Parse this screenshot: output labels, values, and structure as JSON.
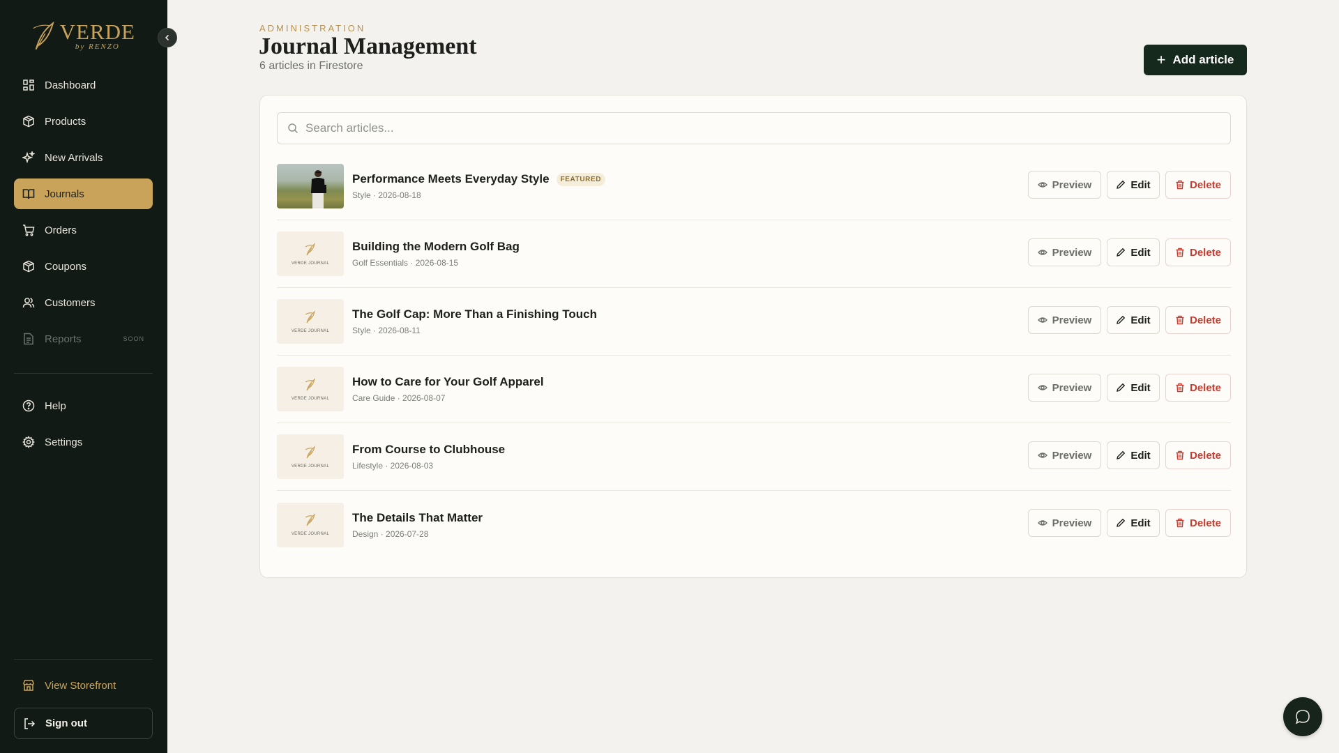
{
  "brand": {
    "name": "VERDE",
    "sub": "by RENZO"
  },
  "nav": {
    "items": [
      {
        "label": "Dashboard",
        "icon": "grid-icon"
      },
      {
        "label": "Products",
        "icon": "box-icon"
      },
      {
        "label": "New Arrivals",
        "icon": "sparkles-icon"
      },
      {
        "label": "Journals",
        "icon": "book-open-icon",
        "active": true
      },
      {
        "label": "Orders",
        "icon": "cart-icon"
      },
      {
        "label": "Coupons",
        "icon": "box-icon"
      },
      {
        "label": "Customers",
        "icon": "users-icon"
      },
      {
        "label": "Reports",
        "icon": "file-icon",
        "badge": "SOON",
        "disabled": true
      }
    ],
    "secondary": [
      {
        "label": "Help",
        "icon": "help-circle-icon"
      },
      {
        "label": "Settings",
        "icon": "gear-icon"
      }
    ],
    "storefront_label": "View Storefront",
    "signout_label": "Sign out"
  },
  "header": {
    "eyebrow": "ADMINISTRATION",
    "title": "Journal Management",
    "subtitle": "6 articles in Firestore",
    "add_label": "Add article"
  },
  "search": {
    "placeholder": "Search articles...",
    "value": ""
  },
  "thumb_placeholder_label": "VERDE JOURNAL",
  "actions": {
    "preview": "Preview",
    "edit": "Edit",
    "delete": "Delete"
  },
  "articles": [
    {
      "title": "Performance Meets Everyday Style",
      "meta": "Style · 2026-08-18",
      "featured": "FEATURED"
    },
    {
      "title": "Building the Modern Golf Bag",
      "meta": "Golf Essentials · 2026-08-15"
    },
    {
      "title": "The Golf Cap: More Than a Finishing Touch",
      "meta": "Style · 2026-08-11"
    },
    {
      "title": "How to Care for Your Golf Apparel",
      "meta": "Care Guide · 2026-08-07"
    },
    {
      "title": "From Course to Clubhouse",
      "meta": "Lifestyle · 2026-08-03"
    },
    {
      "title": "The Details That Matter",
      "meta": "Design · 2026-07-28"
    }
  ],
  "colors": {
    "sidebar_bg": "#121a16",
    "accent_gold": "#c9a35a",
    "primary_dark": "#16291d",
    "danger": "#c53b2f"
  }
}
